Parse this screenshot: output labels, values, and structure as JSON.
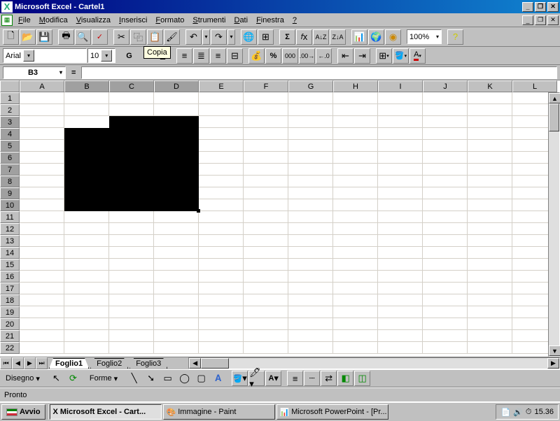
{
  "title": "Microsoft Excel - Cartel1",
  "menu": [
    "File",
    "Modifica",
    "Visualizza",
    "Inserisci",
    "Formato",
    "Strumenti",
    "Dati",
    "Finestra",
    "?"
  ],
  "zoom": "100%",
  "tooltip": "Copia",
  "font": {
    "name": "Arial",
    "size": "10"
  },
  "format_buttons": [
    "G",
    "C",
    "S"
  ],
  "namebox": "B3",
  "formula_prefix": "=",
  "columns": [
    "A",
    "B",
    "C",
    "D",
    "E",
    "F",
    "G",
    "H",
    "I",
    "J",
    "K",
    "L"
  ],
  "rows": [
    "1",
    "2",
    "3",
    "4",
    "5",
    "6",
    "7",
    "8",
    "9",
    "10",
    "11",
    "12",
    "13",
    "14",
    "15",
    "16",
    "17",
    "18",
    "19",
    "20",
    "21",
    "22"
  ],
  "selected_cols": [
    "B",
    "C",
    "D"
  ],
  "selected_rows": [
    "3",
    "4",
    "5",
    "6",
    "7",
    "8",
    "9",
    "10"
  ],
  "selection": {
    "start": "B3",
    "end": "D10",
    "active": "B3"
  },
  "sheets": {
    "active": "Foglio1",
    "others": [
      "Foglio2",
      "Foglio3"
    ]
  },
  "drawing": {
    "menu": "Disegno",
    "shapes": "Forme"
  },
  "status": "Pronto",
  "taskbar": {
    "start": "Avvio",
    "tasks": [
      {
        "label": "Microsoft Excel - Cart...",
        "active": true,
        "icon": "X"
      },
      {
        "label": "Immagine - Paint",
        "active": false,
        "icon": "🎨"
      },
      {
        "label": "Microsoft PowerPoint - [Pr...",
        "active": false,
        "icon": "📊"
      }
    ],
    "clock": "15.36"
  }
}
